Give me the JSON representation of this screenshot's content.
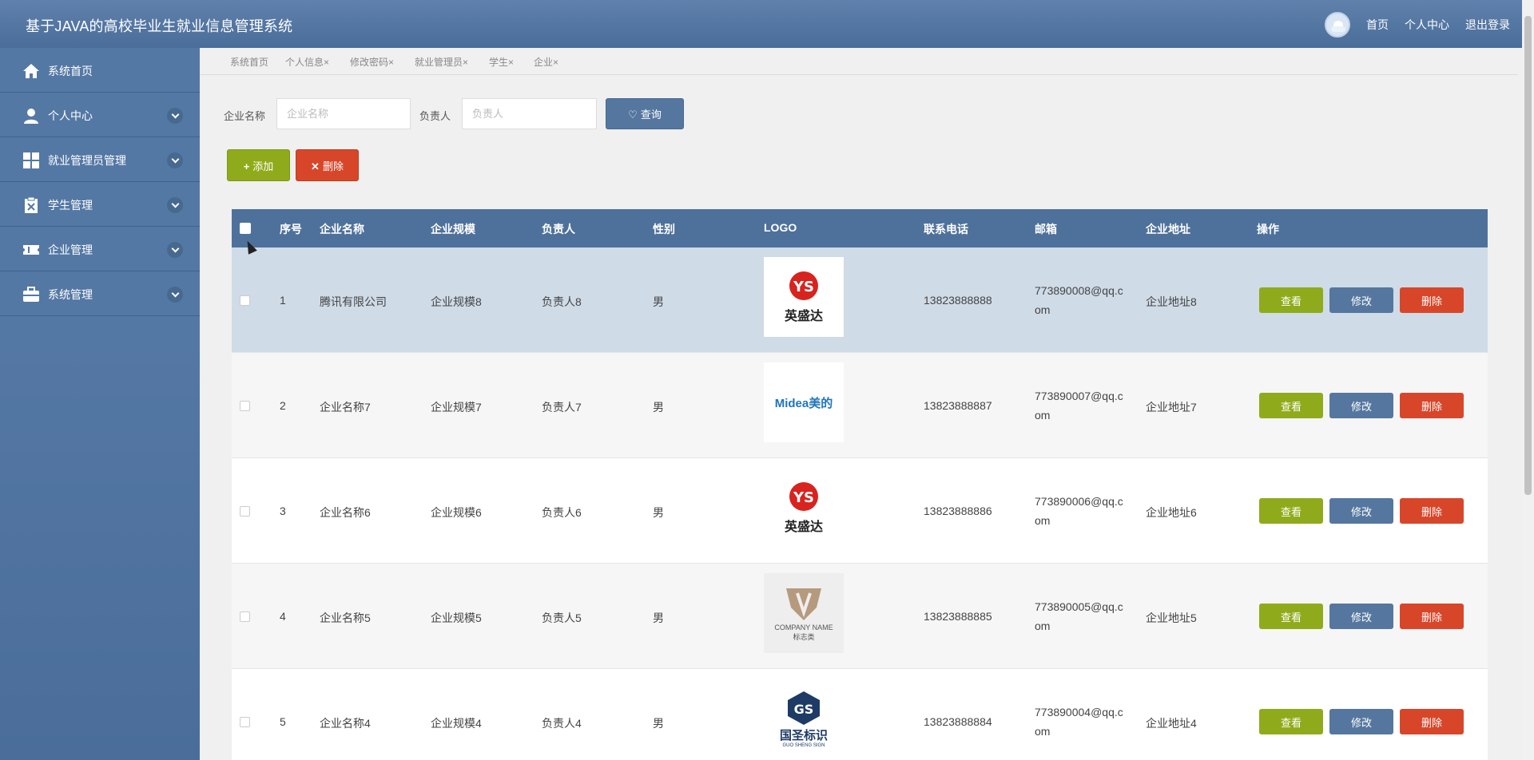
{
  "header": {
    "title": "基于JAVA的高校毕业生就业信息管理系统",
    "links": [
      "首页",
      "个人中心",
      "退出登录"
    ]
  },
  "sidebar": {
    "items": [
      {
        "label": "系统首页",
        "icon": "home-icon",
        "expandable": false
      },
      {
        "label": "个人中心",
        "icon": "user-icon",
        "expandable": true
      },
      {
        "label": "就业管理员管理",
        "icon": "grid-icon",
        "expandable": true
      },
      {
        "label": "学生管理",
        "icon": "clipboard-icon",
        "expandable": true
      },
      {
        "label": "企业管理",
        "icon": "ticket-icon",
        "expandable": true
      },
      {
        "label": "系统管理",
        "icon": "briefcase-icon",
        "expandable": true
      }
    ]
  },
  "tabs": [
    {
      "label": "系统首页"
    },
    {
      "label": "个人信息×"
    },
    {
      "label": "修改密码×"
    },
    {
      "label": "就业管理员×"
    },
    {
      "label": "学生×"
    },
    {
      "label": "企业×"
    }
  ],
  "search": {
    "company_label": "企业名称",
    "company_placeholder": "企业名称",
    "company_value": "",
    "manager_label": "负责人",
    "manager_placeholder": "负责人",
    "manager_value": "",
    "query_label": "查询"
  },
  "toolbar": {
    "add_label": "添加",
    "delete_label": "删除"
  },
  "table": {
    "headers": [
      "序号",
      "企业名称",
      "企业规模",
      "负责人",
      "性别",
      "LOGO",
      "联系电话",
      "邮箱",
      "企业地址",
      "操作"
    ],
    "rows": [
      {
        "no": "1",
        "name": "腾讯有限公司",
        "scale": "企业规模8",
        "manager": "负责人8",
        "gender": "男",
        "logo": "yingshengda",
        "phone": "13823888888",
        "email1": "773890008@qq.c",
        "email2": "om",
        "address": "企业地址8"
      },
      {
        "no": "2",
        "name": "企业名称7",
        "scale": "企业规模7",
        "manager": "负责人7",
        "gender": "男",
        "logo": "midea",
        "phone": "13823888887",
        "email1": "773890007@qq.c",
        "email2": "om",
        "address": "企业地址7"
      },
      {
        "no": "3",
        "name": "企业名称6",
        "scale": "企业规模6",
        "manager": "负责人6",
        "gender": "男",
        "logo": "yingshengda",
        "phone": "13823888886",
        "email1": "773890006@qq.c",
        "email2": "om",
        "address": "企业地址6"
      },
      {
        "no": "4",
        "name": "企业名称5",
        "scale": "企业规模5",
        "manager": "负责人5",
        "gender": "男",
        "logo": "company-name",
        "phone": "13823888885",
        "email1": "773890005@qq.c",
        "email2": "om",
        "address": "企业地址5"
      },
      {
        "no": "5",
        "name": "企业名称4",
        "scale": "企业规模4",
        "manager": "负责人4",
        "gender": "男",
        "logo": "guosheng",
        "phone": "13823888884",
        "email1": "773890004@qq.c",
        "email2": "om",
        "address": "企业地址4"
      }
    ],
    "actions": {
      "view": "查看",
      "edit": "修改",
      "delete": "删除"
    }
  },
  "logos": {
    "yingshengda": {
      "text": "英盛达",
      "mark": "YS"
    },
    "midea": {
      "text": "Midea美的"
    },
    "company-name": {
      "text": "COMPANY NAME",
      "sub": "标志类"
    },
    "guosheng": {
      "text": "国圣标识",
      "sub": "GUO SHENG SIGN",
      "mark": "GS"
    }
  },
  "colors": {
    "header": "#5f81ac",
    "sidebar": "#5478a4",
    "view": "#8fab1b",
    "edit": "#55779f",
    "delete": "#d8462a",
    "selected_row": "#cfdbe7"
  }
}
